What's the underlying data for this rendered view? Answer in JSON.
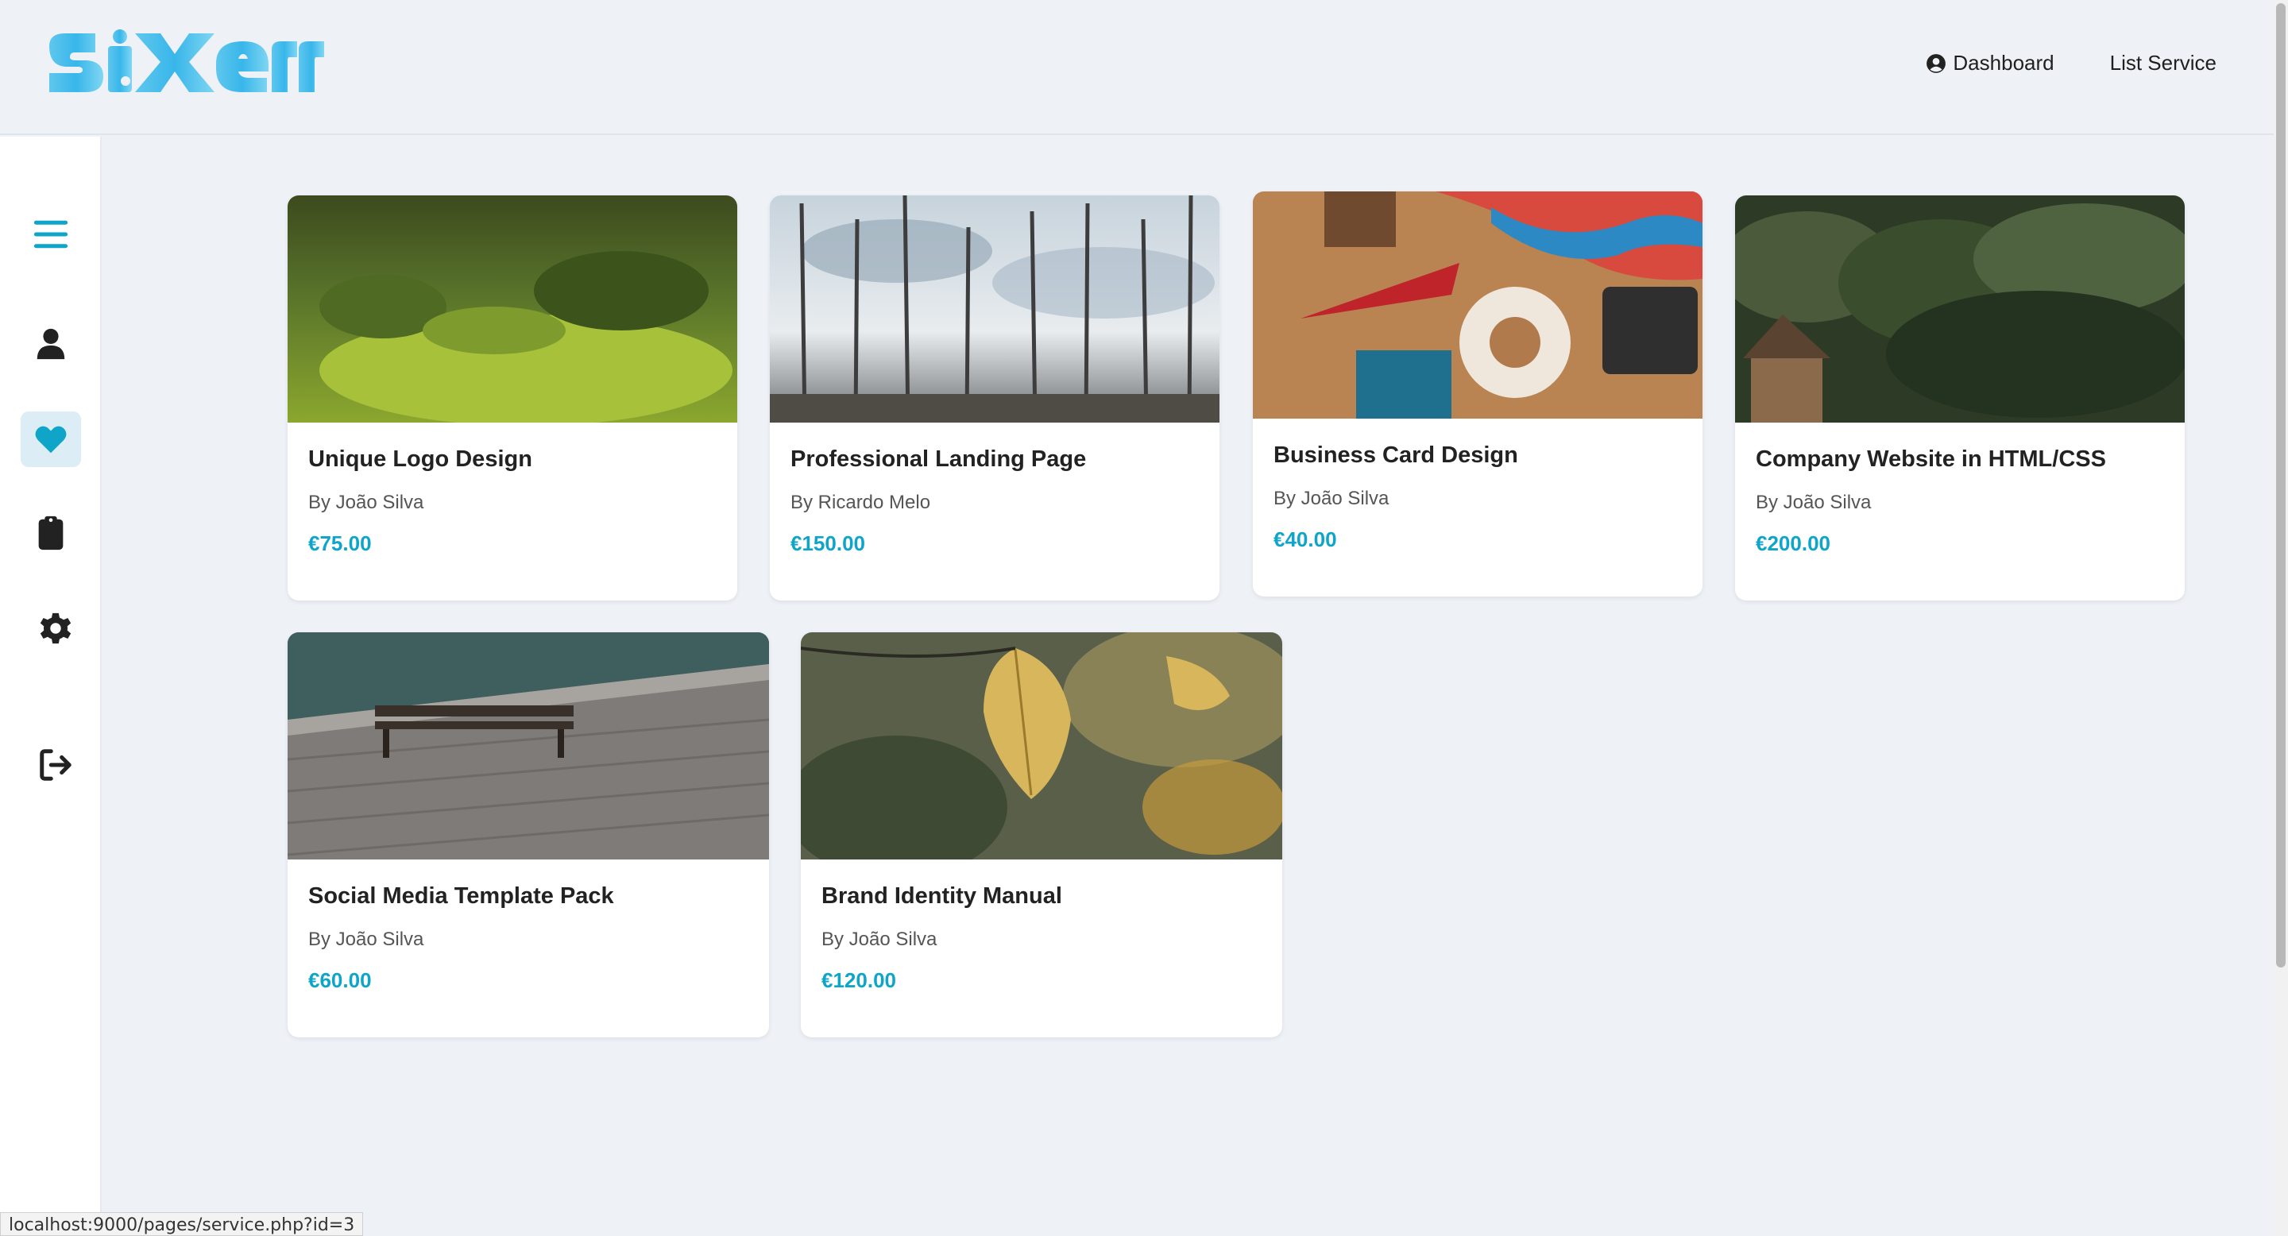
{
  "brand": {
    "logo_text": "sixerr",
    "accent": "#0ea5c9"
  },
  "header": {
    "nav": [
      {
        "label": "Dashboard",
        "icon": "user-circle-icon"
      },
      {
        "label": "List Service"
      }
    ]
  },
  "sidebar": {
    "items": [
      {
        "icon": "menu-icon"
      },
      {
        "icon": "user-icon"
      },
      {
        "icon": "heart-icon",
        "active": true
      },
      {
        "icon": "clipboard-icon"
      },
      {
        "icon": "gear-icon"
      },
      {
        "icon": "logout-icon"
      }
    ]
  },
  "services": [
    {
      "title": "Unique Logo Design",
      "author": "By João Silva",
      "price": "€75.00"
    },
    {
      "title": "Professional Landing Page",
      "author": "By Ricardo Melo",
      "price": "€150.00"
    },
    {
      "title": "Business Card Design",
      "author": "By João Silva",
      "price": "€40.00"
    },
    {
      "title": "Company Website in HTML/CSS",
      "author": "By João Silva",
      "price": "€200.00"
    },
    {
      "title": "Social Media Template Pack",
      "author": "By João Silva",
      "price": "€60.00"
    },
    {
      "title": "Brand Identity Manual",
      "author": "By João Silva",
      "price": "€120.00"
    }
  ],
  "status_bar": {
    "url": "localhost:9000/pages/service.php?id=3"
  }
}
